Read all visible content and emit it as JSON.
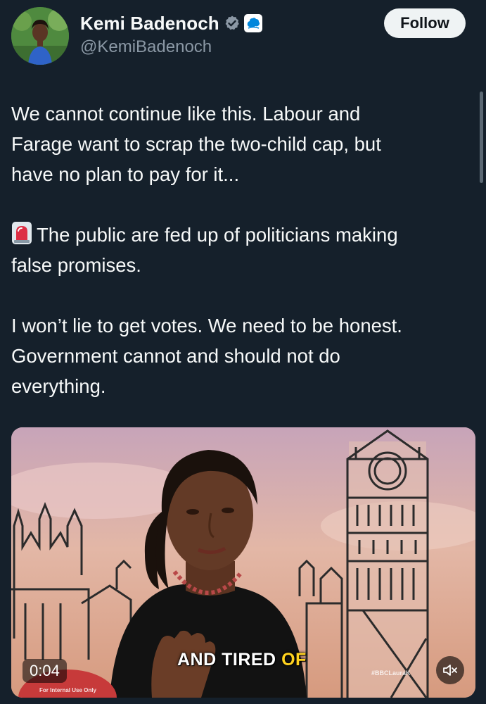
{
  "author": {
    "name": "Kemi Badenoch",
    "handle": "@KemiBadenoch",
    "verified_icon": "verified-badge-icon",
    "affiliation_icon": "conservative-tree-icon"
  },
  "follow_label": "Follow",
  "tweet": {
    "paragraph1": "We cannot continue like this. Labour and\nFarage want to scrap the two-child cap, but\nhave no plan to pay for it...",
    "paragraph2_emoji": "siren-icon",
    "paragraph2": "The public are fed up of politicians making\nfalse promises.",
    "paragraph3": "I won’t lie to get votes. We need to be honest.\nGovernment cannot and should not do\neverything."
  },
  "video": {
    "caption_white": "AND TIRED ",
    "caption_yellow": "OF",
    "duration": "0:04",
    "watermark": "#BBCLauraK",
    "internal_label": "For Internal Use Only",
    "mute_icon": "muted-speaker-icon"
  },
  "colors": {
    "background": "#15202b",
    "text": "#f7f9f9",
    "secondary_text": "#8b98a5",
    "verified_blue": "#1d9bf0",
    "caption_yellow": "#ffd21f"
  }
}
